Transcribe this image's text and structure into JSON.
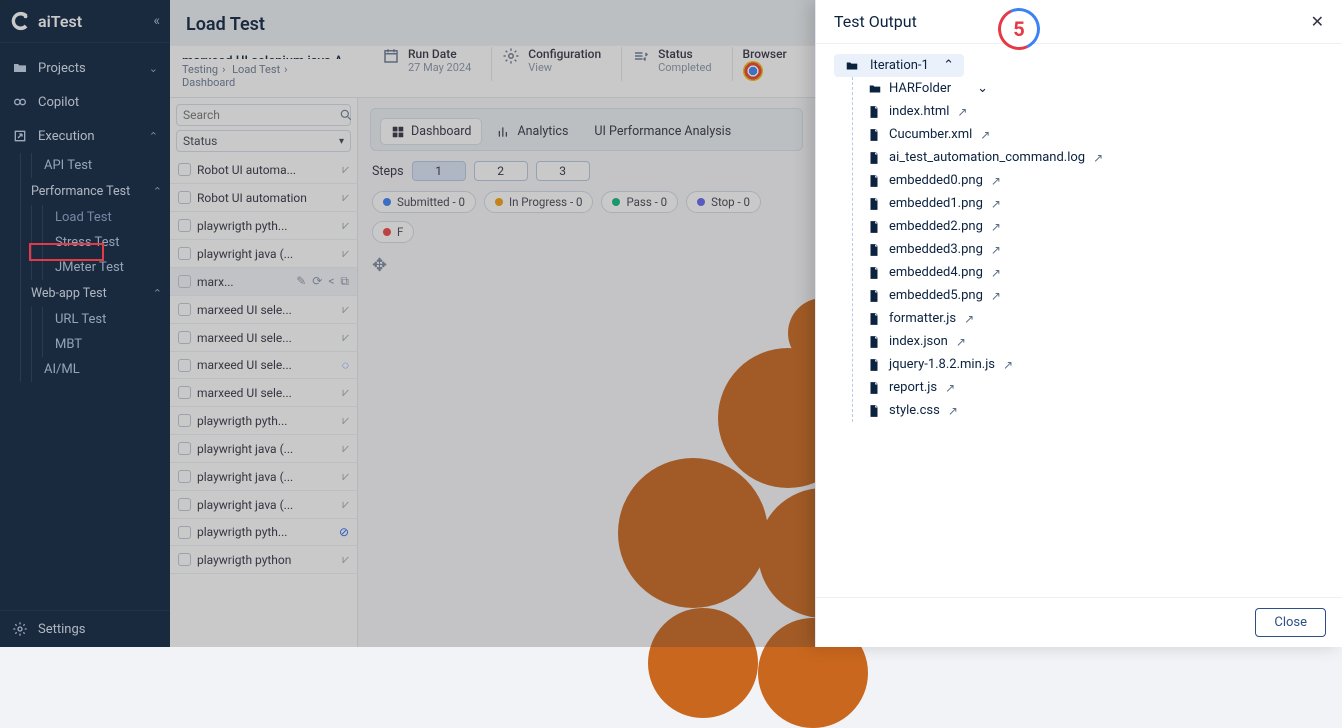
{
  "app": {
    "name": "aiTest"
  },
  "annotation": {
    "step": "5"
  },
  "sidebar": {
    "projects": "Projects",
    "copilot": "Copilot",
    "execution": "Execution",
    "subs": {
      "api": "API Test",
      "perf": "Performance Test",
      "load": "Load Test",
      "stress": "Stress Test",
      "jmeter": "JMeter Test",
      "webapp": "Web-app Test",
      "url": "URL Test",
      "mbt": "MBT",
      "aiml": "AI/ML"
    },
    "settings": "Settings"
  },
  "page": {
    "title": "Load Test"
  },
  "breadcrumb": {
    "title": "marxeed UI selenium java A...",
    "path": [
      "Testing",
      "Load Test",
      "Dashboard"
    ]
  },
  "info": {
    "rundate_label": "Run Date",
    "rundate_value": "27 May 2024",
    "config_label": "Configuration",
    "config_value": "View",
    "status_label": "Status",
    "status_value": "Completed",
    "browser_label": "Browser"
  },
  "search": {
    "placeholder": "Search"
  },
  "status_filter": {
    "label": "Status"
  },
  "list": [
    {
      "name": "Robot UI automa...",
      "state": "done"
    },
    {
      "name": "Robot UI automation",
      "state": "done"
    },
    {
      "name": "playwrigth pyth...",
      "state": "done"
    },
    {
      "name": "playwright java (...",
      "state": "done"
    },
    {
      "name": "marx...",
      "state": "selected"
    },
    {
      "name": "marxeed UI sele...",
      "state": "done"
    },
    {
      "name": "marxeed UI sele...",
      "state": "done"
    },
    {
      "name": "marxeed UI sele...",
      "state": "ring"
    },
    {
      "name": "marxeed UI sele...",
      "state": "done"
    },
    {
      "name": "playwrigth pyth...",
      "state": "done"
    },
    {
      "name": "playwright java (...",
      "state": "done"
    },
    {
      "name": "playwright java (...",
      "state": "done"
    },
    {
      "name": "playwright java (...",
      "state": "done"
    },
    {
      "name": "playwrigth pyth...",
      "state": "ringx"
    },
    {
      "name": "playwrigth python",
      "state": "done"
    }
  ],
  "tabs": {
    "dashboard": "Dashboard",
    "analytics": "Analytics",
    "perf": "UI Performance Analysis"
  },
  "steps": {
    "label": "Steps",
    "items": [
      "1",
      "2",
      "3"
    ]
  },
  "chips": {
    "submitted": "Submitted - 0",
    "inprogress": "In Progress - 0",
    "pass": "Pass - 0",
    "stop": "Stop - 0",
    "fail": "F"
  },
  "panel": {
    "title": "Test Output",
    "close": "Close",
    "root": "Iteration-1",
    "harfolder": "HARFolder",
    "files": [
      "index.html",
      "Cucumber.xml",
      "ai_test_automation_command.log",
      "embedded0.png",
      "embedded1.png",
      "embedded2.png",
      "embedded3.png",
      "embedded4.png",
      "embedded5.png",
      "formatter.js",
      "index.json",
      "jquery-1.8.2.min.js",
      "report.js",
      "style.css"
    ]
  }
}
